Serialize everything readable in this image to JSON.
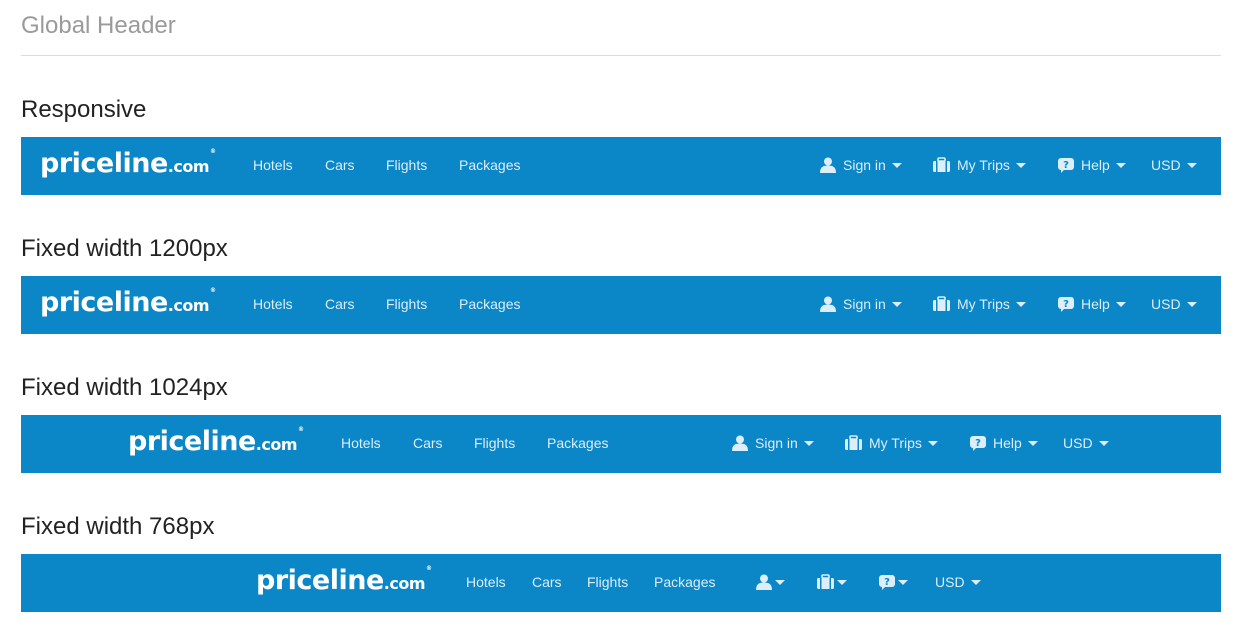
{
  "page": {
    "title": "Global Header"
  },
  "colors": {
    "bar_background": "#0b86c6",
    "bar_text": "#dbeefa",
    "logo": "#ffffff"
  },
  "logo": {
    "main": "priceline",
    "tld": ".com",
    "mark": "®"
  },
  "icons": {
    "user": "user-icon",
    "trips": "suitcase-icon",
    "help": "help-bubble-icon",
    "dropdown": "caret-down-icon"
  },
  "sections": [
    {
      "title": "Responsive",
      "nav": [
        "Hotels",
        "Cars",
        "Flights",
        "Packages"
      ],
      "utility": {
        "sign_in": "Sign in",
        "my_trips": "My Trips",
        "help": "Help",
        "currency": "USD"
      }
    },
    {
      "title": "Fixed width 1200px",
      "nav": [
        "Hotels",
        "Cars",
        "Flights",
        "Packages"
      ],
      "utility": {
        "sign_in": "Sign in",
        "my_trips": "My Trips",
        "help": "Help",
        "currency": "USD"
      }
    },
    {
      "title": "Fixed width 1024px",
      "nav": [
        "Hotels",
        "Cars",
        "Flights",
        "Packages"
      ],
      "utility": {
        "sign_in": "Sign in",
        "my_trips": "My Trips",
        "help": "Help",
        "currency": "USD"
      }
    },
    {
      "title": "Fixed width 768px",
      "nav": [
        "Hotels",
        "Cars",
        "Flights",
        "Packages"
      ],
      "utility": {
        "currency": "USD"
      }
    }
  ]
}
